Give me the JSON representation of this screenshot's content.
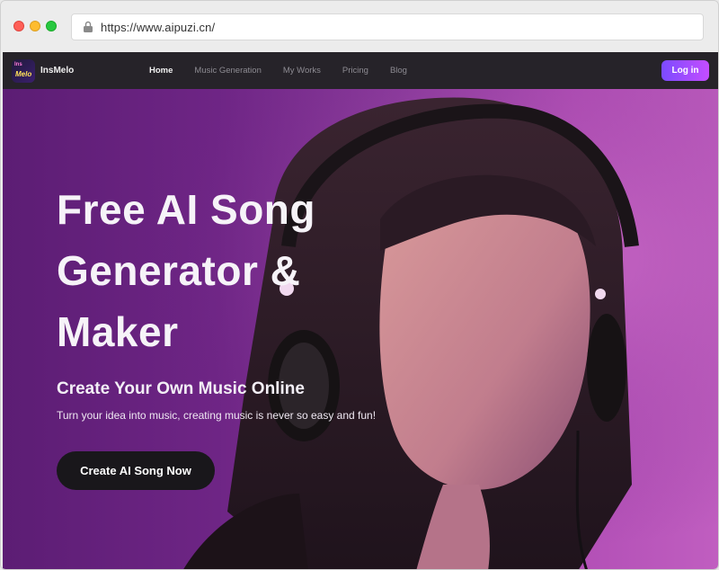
{
  "browser": {
    "url": "https://www.aipuzi.cn/"
  },
  "site": {
    "brand_name": "InsMelo",
    "logo_text_top": "Ins",
    "logo_text_bottom": "Melo"
  },
  "nav": {
    "items": [
      {
        "label": "Home",
        "active": true
      },
      {
        "label": "Music Generation",
        "active": false
      },
      {
        "label": "My Works",
        "active": false
      },
      {
        "label": "Pricing",
        "active": false
      },
      {
        "label": "Blog",
        "active": false
      }
    ],
    "login_label": "Log in"
  },
  "hero": {
    "title_lines": [
      "Free AI Song",
      "Generator &",
      "Maker"
    ],
    "subtitle": "Create Your Own Music Online",
    "description": "Turn your idea into music, creating music is never so easy and fun!",
    "cta_label": "Create AI Song Now"
  },
  "colors": {
    "nav_bg": "#262329",
    "accent_gradient_start": "#7b4bff",
    "accent_gradient_end": "#c44dff",
    "hero_bg": "#6e2585",
    "cta_bg": "#19171b"
  }
}
